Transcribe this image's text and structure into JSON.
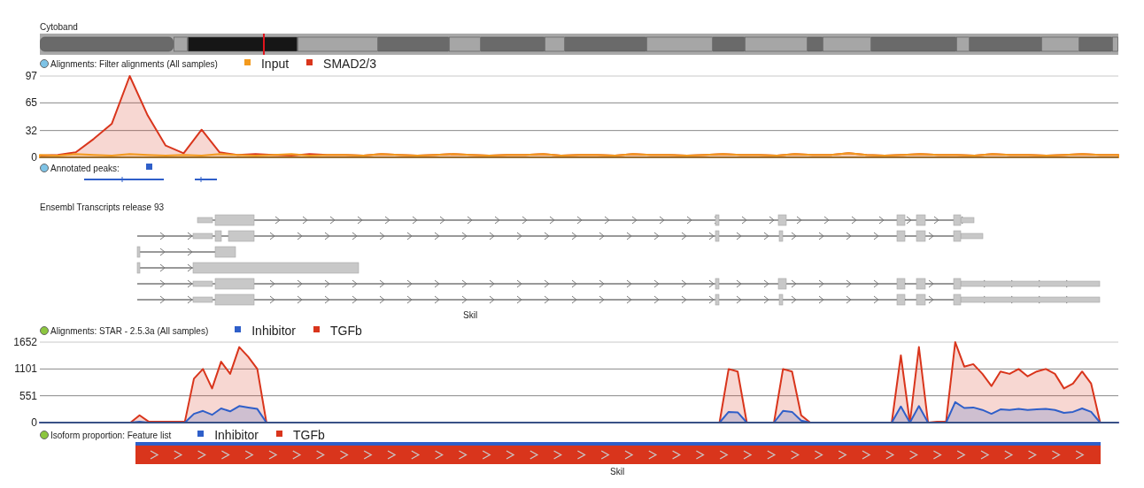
{
  "tracks": [
    {
      "kind": "cytoband",
      "title": "Cytoband"
    },
    {
      "kind": "coverage",
      "title": "Alignments: Filter alignments (All samples)",
      "color": "#7ec3e6",
      "chart_data": {
        "type": "area",
        "ylim": [
          0,
          97
        ],
        "yticks": [
          0,
          32,
          65,
          97
        ],
        "series": [
          {
            "name": "Input",
            "color": "#f39a1e",
            "values": [
              3,
              2,
              4,
              3,
              2,
              4,
              3,
              2,
              3,
              2,
              4,
              3,
              2,
              3,
              4,
              2,
              3,
              3,
              2,
              4,
              3,
              2,
              3,
              4,
              3,
              2,
              3,
              3,
              4,
              2,
              3,
              3,
              2,
              4,
              3,
              3,
              2,
              3,
              4,
              3,
              3,
              2,
              4,
              3,
              3,
              5,
              3,
              2,
              3,
              4,
              3,
              3,
              2,
              4,
              3,
              3,
              2,
              3,
              4,
              3,
              3
            ]
          },
          {
            "name": "SMAD2/3",
            "color": "#d9351c",
            "values": [
              2,
              3,
              6,
              22,
              40,
              97,
              50,
              14,
              5,
              33,
              6,
              3,
              4,
              3,
              2,
              4,
              3,
              3,
              2,
              4,
              3,
              2,
              3,
              4,
              3,
              2,
              3,
              3,
              4,
              2,
              3,
              3,
              2,
              4,
              3,
              3,
              2,
              3,
              4,
              3,
              3,
              2,
              4,
              3,
              3,
              5,
              3,
              2,
              3,
              4,
              3,
              3,
              2,
              4,
              3,
              3,
              2,
              3,
              4,
              3,
              3
            ]
          }
        ]
      }
    },
    {
      "kind": "peaks",
      "title": "Annotated peaks:",
      "color": "#7ec3e6",
      "legend": [
        {
          "color": "#2f5fc9"
        }
      ]
    },
    {
      "kind": "transcripts",
      "title": "Ensembl Transcripts release 93",
      "gene": "Skil"
    },
    {
      "kind": "coverage",
      "title": "Alignments: STAR - 2.5.3a (All samples)",
      "color": "#8cc63f",
      "chart_data": {
        "type": "area",
        "ylim": [
          0,
          1652
        ],
        "yticks": [
          0,
          551,
          1101,
          1652
        ],
        "series": [
          {
            "name": "Inhibitor",
            "color": "#2f5fc9",
            "values": [
              0,
              0,
              0,
              0,
              0,
              0,
              0,
              0,
              0,
              0,
              0,
              20,
              0,
              0,
              0,
              0,
              0,
              180,
              240,
              160,
              290,
              230,
              340,
              310,
              280,
              0,
              0,
              0,
              0,
              0,
              0,
              0,
              0,
              0,
              0,
              0,
              0,
              0,
              0,
              0,
              0,
              0,
              0,
              0,
              0,
              0,
              0,
              0,
              0,
              0,
              0,
              0,
              0,
              0,
              0,
              0,
              0,
              0,
              0,
              0,
              0,
              0,
              0,
              0,
              0,
              0,
              0,
              0,
              0,
              0,
              0,
              0,
              0,
              0,
              0,
              0,
              220,
              210,
              0,
              0,
              0,
              0,
              240,
              220,
              40,
              0,
              0,
              0,
              0,
              0,
              0,
              0,
              0,
              0,
              0,
              330,
              0,
              340,
              0,
              0,
              0,
              420,
              300,
              310,
              260,
              180,
              270,
              260,
              280,
              260,
              270,
              280,
              260,
              200,
              220,
              290,
              220,
              0,
              0,
              0
            ]
          },
          {
            "name": "TGFb",
            "color": "#d9351c",
            "values": [
              0,
              0,
              0,
              0,
              0,
              0,
              0,
              0,
              0,
              0,
              0,
              150,
              20,
              20,
              20,
              20,
              20,
              900,
              1100,
              700,
              1250,
              1000,
              1550,
              1350,
              1100,
              0,
              0,
              0,
              0,
              0,
              0,
              0,
              0,
              0,
              0,
              0,
              0,
              0,
              0,
              0,
              0,
              0,
              0,
              0,
              0,
              0,
              0,
              0,
              0,
              0,
              0,
              0,
              0,
              0,
              0,
              0,
              0,
              0,
              0,
              0,
              0,
              0,
              0,
              0,
              0,
              0,
              0,
              0,
              0,
              0,
              0,
              0,
              0,
              0,
              0,
              0,
              1100,
              1050,
              0,
              0,
              0,
              0,
              1100,
              1050,
              150,
              0,
              0,
              0,
              0,
              0,
              0,
              0,
              0,
              0,
              0,
              1380,
              0,
              1550,
              0,
              20,
              20,
              1650,
              1150,
              1200,
              1000,
              750,
              1050,
              1000,
              1100,
              950,
              1050,
              1100,
              1000,
              700,
              800,
              1050,
              800,
              0,
              0,
              0
            ]
          }
        ]
      }
    },
    {
      "kind": "isoform",
      "title": "Isoform proportion: Feature list",
      "color": "#8cc63f",
      "legend": [
        {
          "label": "Inhibitor",
          "color": "#2f5fc9"
        },
        {
          "label": "TGFb",
          "color": "#d9351c"
        }
      ],
      "gene": "Skil"
    }
  ]
}
